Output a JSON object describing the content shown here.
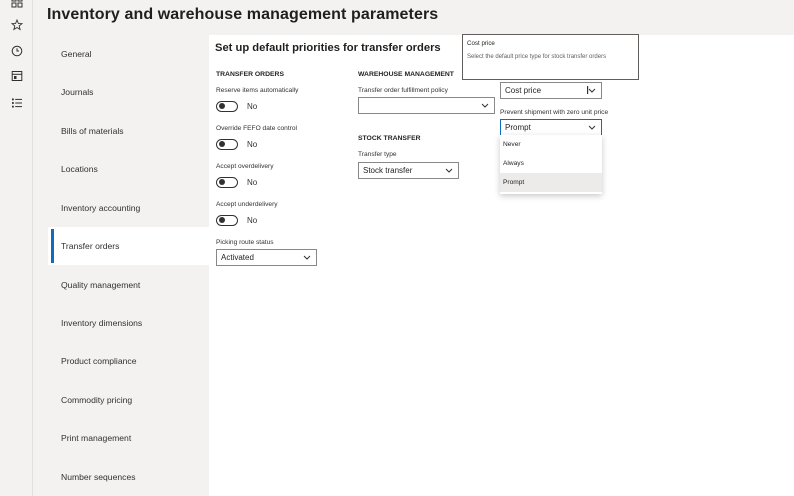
{
  "rail": {
    "icons": [
      "grid-icon",
      "star-icon",
      "clock-icon",
      "workspace-icon",
      "list-icon"
    ]
  },
  "header": {
    "title": "Inventory and warehouse management parameters"
  },
  "nav": {
    "items": [
      {
        "label": "General"
      },
      {
        "label": "Journals"
      },
      {
        "label": "Bills of materials"
      },
      {
        "label": "Locations"
      },
      {
        "label": "Inventory accounting"
      },
      {
        "label": "Transfer orders"
      },
      {
        "label": "Quality management"
      },
      {
        "label": "Inventory dimensions"
      },
      {
        "label": "Product compliance"
      },
      {
        "label": "Commodity pricing"
      },
      {
        "label": "Print management"
      },
      {
        "label": "Number sequences"
      }
    ],
    "active": "Transfer orders"
  },
  "main": {
    "section_title": "Set up default priorities for transfer orders",
    "transfer_orders": {
      "heading": "TRANSFER ORDERS",
      "reserve_label": "Reserve items automatically",
      "reserve_value": "No",
      "fefo_label": "Override FEFO date control",
      "fefo_value": "No",
      "overdelivery_label": "Accept overdelivery",
      "overdelivery_value": "No",
      "underdelivery_label": "Accept underdelivery",
      "underdelivery_value": "No",
      "picking_label": "Picking route status",
      "picking_value": "Activated"
    },
    "warehouse": {
      "heading": "WAREHOUSE MANAGEMENT",
      "fulfillment_label": "Transfer order fulfillment policy",
      "fulfillment_value": ""
    },
    "stock_transfer": {
      "heading": "STOCK TRANSFER",
      "type_label": "Transfer type",
      "type_value": "Stock transfer"
    },
    "price": {
      "price_type_value": "Cost price",
      "zero_price_label": "Prevent shipment with zero unit price",
      "zero_price_value": "Prompt",
      "options": [
        "Never",
        "Always",
        "Prompt"
      ],
      "selected_option": "Prompt"
    }
  },
  "tooltip": {
    "title": "Cost price",
    "body": "Select the default price type for stock transfer orders"
  },
  "colors": {
    "accent": "#0f6cbd",
    "background": "#f3f2f1",
    "content_bg": "#ffffff"
  }
}
